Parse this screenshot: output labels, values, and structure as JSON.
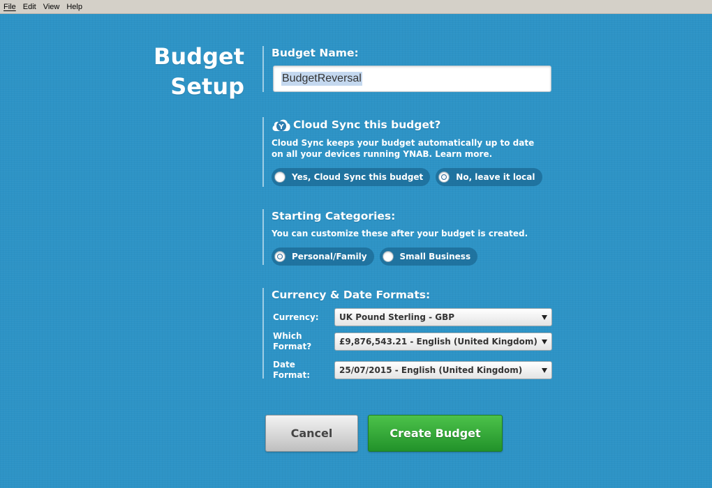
{
  "menubar": {
    "items": [
      "File",
      "Edit",
      "View",
      "Help"
    ]
  },
  "title": {
    "line1": "Budget",
    "line2": "Setup"
  },
  "budget_name": {
    "label": "Budget Name:",
    "value": "BudgetReversal"
  },
  "cloud_sync": {
    "heading": "Cloud Sync this budget?",
    "icon_letter": "Y",
    "description": "Cloud Sync keeps your budget automatically up to date on all your devices running YNAB. Learn more.",
    "options": [
      {
        "label": "Yes, Cloud Sync this budget",
        "selected": false
      },
      {
        "label": "No, leave it local",
        "selected": true
      }
    ]
  },
  "starting_categories": {
    "heading": "Starting Categories:",
    "description": "You can customize these after your budget is created.",
    "options": [
      {
        "label": "Personal/Family",
        "selected": true
      },
      {
        "label": "Small Business",
        "selected": false
      }
    ]
  },
  "formats": {
    "heading": "Currency & Date Formats:",
    "currency_label": "Currency:",
    "currency_value": "UK Pound Sterling - GBP",
    "format_label_line1": "Which",
    "format_label_line2": "Format?",
    "format_value": "£9,876,543.21 - English (United Kingdom)",
    "date_label": "Date Format:",
    "date_value": "25/07/2015 - English (United Kingdom)"
  },
  "buttons": {
    "cancel": "Cancel",
    "create": "Create Budget"
  },
  "colors": {
    "background": "#2d93c6",
    "create_button": "#2fa834",
    "cancel_button": "#d9d9d9"
  }
}
